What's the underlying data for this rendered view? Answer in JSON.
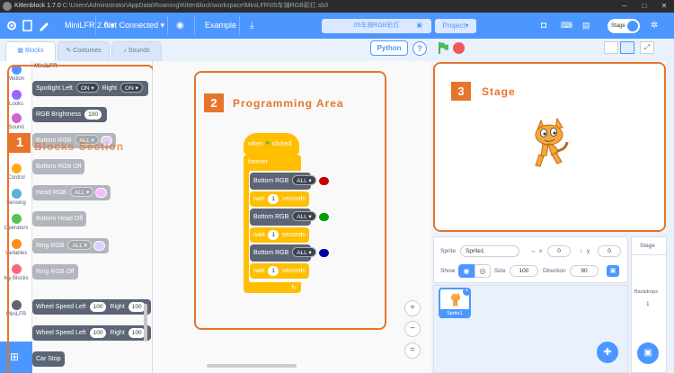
{
  "window": {
    "title": "Kittenblock 1.7.0",
    "path": "C:\\Users\\Administrator\\AppData\\Roaming\\Kittenblock\\workspace\\MiniLFR\\05车骑RGB彩灯.sb3"
  },
  "menubar": {
    "device": "MiniLFR 2.0",
    "connection": "Not Connected",
    "example": "Example",
    "project_name": "05车骑RGB彩灯",
    "project_menu": "Project",
    "stage_toggle": "Stage"
  },
  "tabs": {
    "blocks": "Blocks",
    "costumes": "Costumes",
    "sounds": "Sounds"
  },
  "categories": [
    {
      "label": "Motion",
      "color": "#4c97ff"
    },
    {
      "label": "Looks",
      "color": "#9966ff"
    },
    {
      "label": "Sound",
      "color": "#cf63cf"
    },
    {
      "label": "Control",
      "color": "#ffab19"
    },
    {
      "label": "Sensing",
      "color": "#5cb1d6"
    },
    {
      "label": "Operators",
      "color": "#59c059"
    },
    {
      "label": "Variables",
      "color": "#ff8c1a"
    },
    {
      "label": "My Blocks",
      "color": "#ff6680"
    },
    {
      "label": "MiniLFR",
      "color": "#5b6575"
    }
  ],
  "palette": {
    "section_title": "MiniLFR",
    "spotlight_left": "Spotlight Left",
    "on": "ON",
    "right": "Right",
    "rgb_brightness": "RGB Brightness",
    "brightness_value": "100",
    "bottom_rgb": "Bottom RGB",
    "all": "ALL",
    "bottom_rgb_off": "Bottom RGB Off",
    "head_rgb": "Head RGB",
    "bottom_head_off": "Bottom Head Off",
    "ring_rgb": "Ring RGB",
    "ring_rgb_off": "Ring RGB Off",
    "wheel_speed_left": "Wheel Speed Left",
    "speed_value": "100",
    "right_label": "Right",
    "car_stop": "Car Stop"
  },
  "annotations": {
    "one_num": "1",
    "one_label": "Blocks Section",
    "two_num": "2",
    "two_label": "Programming Area",
    "three_num": "3",
    "three_label": "Stage"
  },
  "script": {
    "when": "when",
    "clicked": "clicked",
    "forever": "forever",
    "bottom_rgb": "Bottom RGB",
    "all": "ALL",
    "wait": "wait",
    "wait_value": "1",
    "seconds": "seconds",
    "colors": [
      "#c00000",
      "#00a000",
      "#0000a0"
    ]
  },
  "toolbar": {
    "python": "Python",
    "help": "?"
  },
  "sprite_info": {
    "sprite_label": "Sprite",
    "sprite_name": "Sprite1",
    "x_label": "x",
    "x_value": "0",
    "y_label": "y",
    "y_value": "0",
    "show_label": "Show",
    "size_label": "Size",
    "size_value": "100",
    "direction_label": "Direction",
    "direction_value": "90"
  },
  "sprite_list": {
    "items": [
      {
        "name": "Sprite1"
      }
    ]
  },
  "stage_panel": {
    "title": "Stage",
    "backdrops_label": "Backdrops",
    "backdrops_count": "1"
  }
}
